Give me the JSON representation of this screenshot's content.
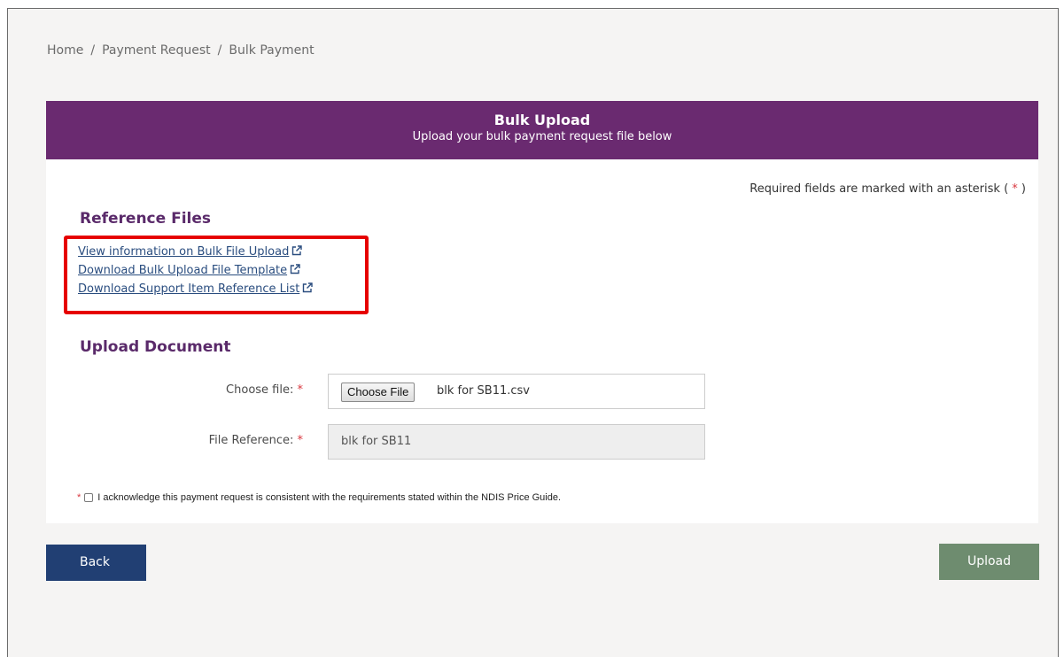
{
  "breadcrumb": {
    "home": "Home",
    "separator": "/",
    "payment_request": "Payment Request",
    "bulk_payment": "Bulk Payment"
  },
  "header": {
    "title": "Bulk Upload",
    "subtitle": "Upload your bulk payment request file below"
  },
  "required_note": {
    "text": "Required fields are marked with an asterisk (",
    "star": "*",
    "close": ")"
  },
  "reference_files": {
    "title": "Reference Files",
    "links": [
      "View information on Bulk File Upload",
      "Download Bulk Upload File Template",
      "Download Support Item Reference List"
    ]
  },
  "upload_document": {
    "title": "Upload Document",
    "choose_file_label": "Choose file:",
    "choose_file_button": "Choose File",
    "selected_file": "blk for SB11.csv",
    "file_reference_label": "File Reference:",
    "file_reference_value": "blk for SB11",
    "required_star": "*"
  },
  "acknowledgement": {
    "star": "*",
    "text": "I acknowledge this payment request is consistent with the requirements stated within the NDIS Price Guide.",
    "checked": false
  },
  "buttons": {
    "back": "Back",
    "upload": "Upload"
  },
  "colors": {
    "header_bg": "#6a2a70",
    "section_title": "#5a2a6a",
    "link": "#2a4d7f",
    "highlight": "#e60000",
    "asterisk": "#d9373f",
    "back_button": "#213f73",
    "upload_button": "#6e8c6f",
    "page_bg": "#f5f4f3"
  },
  "icons": {
    "external_link": "external-link-icon"
  }
}
